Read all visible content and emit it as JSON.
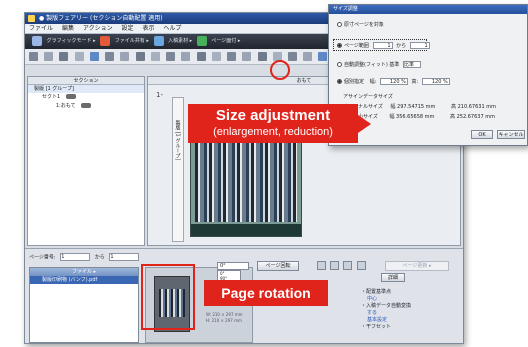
{
  "window": {
    "title": "● 製版フェアリー  (セクション自動配置 適用)",
    "menu": [
      "ファイル",
      "編集",
      "アクション",
      "設定",
      "表示",
      "ヘルプ"
    ]
  },
  "toolbar": {
    "items": [
      "グラフィックモード ▸",
      "ファイル共有 ▸",
      "入稿素材 ▸",
      "ページ面付 ▸"
    ]
  },
  "tree": {
    "header": "セクション",
    "selected": "製版 [1 グループ]",
    "row1": "セクト1",
    "row2": "1:おもて"
  },
  "work": {
    "header": "おもて",
    "page_number": "1-",
    "side_label": "製版 [1 グループ]"
  },
  "bottom": {
    "page_label": "ページ番号:",
    "page_from": "1",
    "page_to_label": "から",
    "page_to": "1",
    "file_header": "ファイル ▸",
    "file_row": "製版印刷物 (バンフ).pdf",
    "rotation_value": "0°",
    "rotation_options": [
      "0°",
      "90°",
      "180°",
      "270°"
    ],
    "page_button": "ページ回転",
    "detail_button": "詳細",
    "disabled_button": "ページ更新 ▸",
    "thumb_info": [
      "W: 210 × 297 mm",
      "H: 210 × 297 mm"
    ],
    "info_title": "・配置基準点",
    "info_links": [
      "中心",
      "・入稿データ自動変換",
      "する",
      "基本設定"
    ],
    "info_last": "・干フセット"
  },
  "dialog": {
    "title": "サイズ調整",
    "opt1": "原寸ページを対象",
    "opt2": "ページ範囲",
    "range_from": "1",
    "range_mid": "から",
    "range_to": "1",
    "opt3": "自動調整(フィット) 基準",
    "opt3_value": "比率",
    "opt4": "個別指定",
    "w_label": "幅:",
    "w_value": "120 %",
    "h_label": "高:",
    "h_value": "120 %",
    "section": "アサインデータサイズ",
    "orig_label": "オリジナルサイズ",
    "orig_w": "幅 297.54715 mm",
    "orig_h": "高 210.67631 mm",
    "scaled_label": "拡大縮小サイズ",
    "scaled_w": "幅 356.65658 mm",
    "scaled_h": "高 252.67637 mm",
    "ok": "OK",
    "cancel": "キャンセル"
  },
  "callouts": {
    "size_title": "Size adjustment",
    "size_sub": "(enlargement, reduction)",
    "rotation": "Page rotation"
  },
  "colors": {
    "callout_red": "#e0231b",
    "title_blue": "#2f5aa8",
    "selection_blue": "#3a67b3"
  }
}
